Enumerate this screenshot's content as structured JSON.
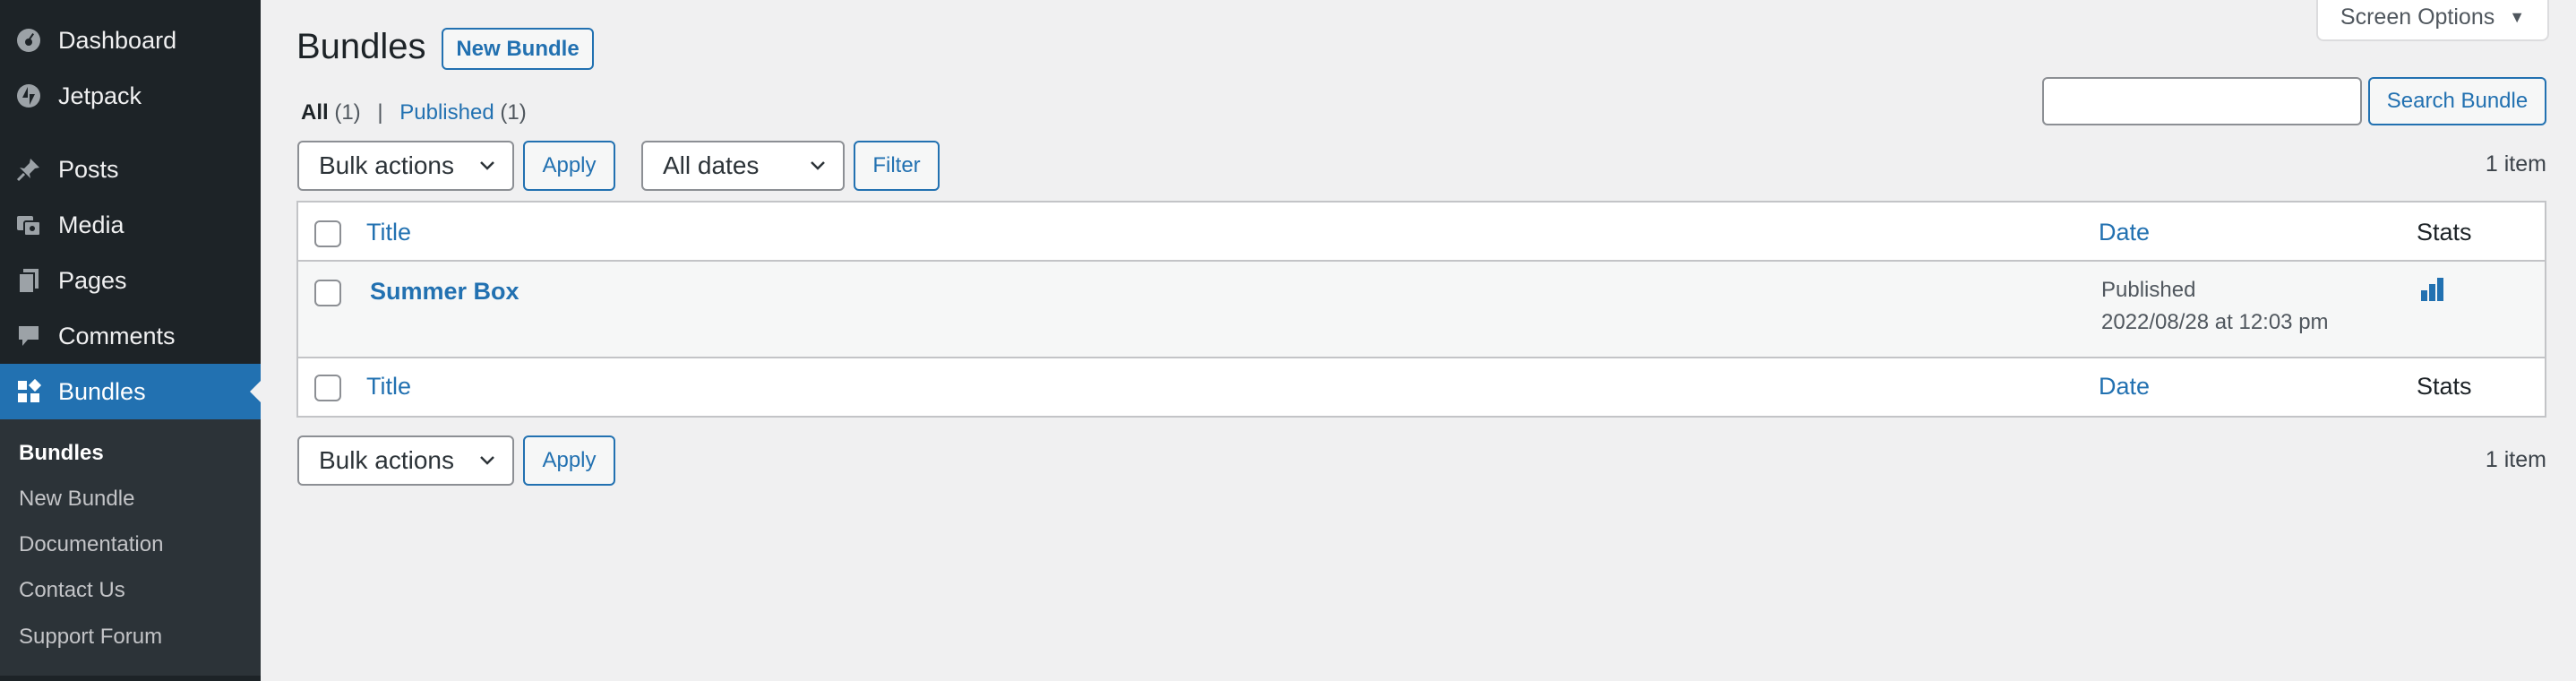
{
  "sidebar": {
    "items": [
      {
        "label": "Dashboard",
        "icon": "dashboard-icon"
      },
      {
        "label": "Jetpack",
        "icon": "jetpack-icon"
      },
      {
        "label": "Posts",
        "icon": "pin-icon"
      },
      {
        "label": "Media",
        "icon": "media-icon"
      },
      {
        "label": "Pages",
        "icon": "pages-icon"
      },
      {
        "label": "Comments",
        "icon": "comment-icon"
      },
      {
        "label": "Bundles",
        "icon": "grid-icon"
      }
    ],
    "submenu": [
      "Bundles",
      "New Bundle",
      "Documentation",
      "Contact Us",
      "Support Forum"
    ]
  },
  "header": {
    "title": "Bundles",
    "new_button": "New Bundle",
    "screen_options": "Screen Options"
  },
  "views": {
    "all_label": "All",
    "all_count": "(1)",
    "separator": "|",
    "published_label": "Published",
    "published_count": "(1)"
  },
  "search": {
    "button": "Search Bundle",
    "value": ""
  },
  "tablenav_top": {
    "bulk_select": "Bulk actions",
    "apply": "Apply",
    "date_select": "All dates",
    "filter": "Filter",
    "count": "1 item"
  },
  "table": {
    "columns": {
      "title": "Title",
      "date": "Date",
      "stats": "Stats"
    },
    "rows": [
      {
        "title": "Summer Box",
        "status": "Published",
        "date": "2022/08/28 at 12:03 pm",
        "stats_icon": "bar-chart-icon"
      }
    ]
  },
  "tablenav_bottom": {
    "bulk_select": "Bulk actions",
    "apply": "Apply",
    "count": "1 item"
  },
  "colors": {
    "accent": "#2271b1",
    "sidebar_bg": "#1d2327",
    "page_bg": "#f0f0f1"
  }
}
